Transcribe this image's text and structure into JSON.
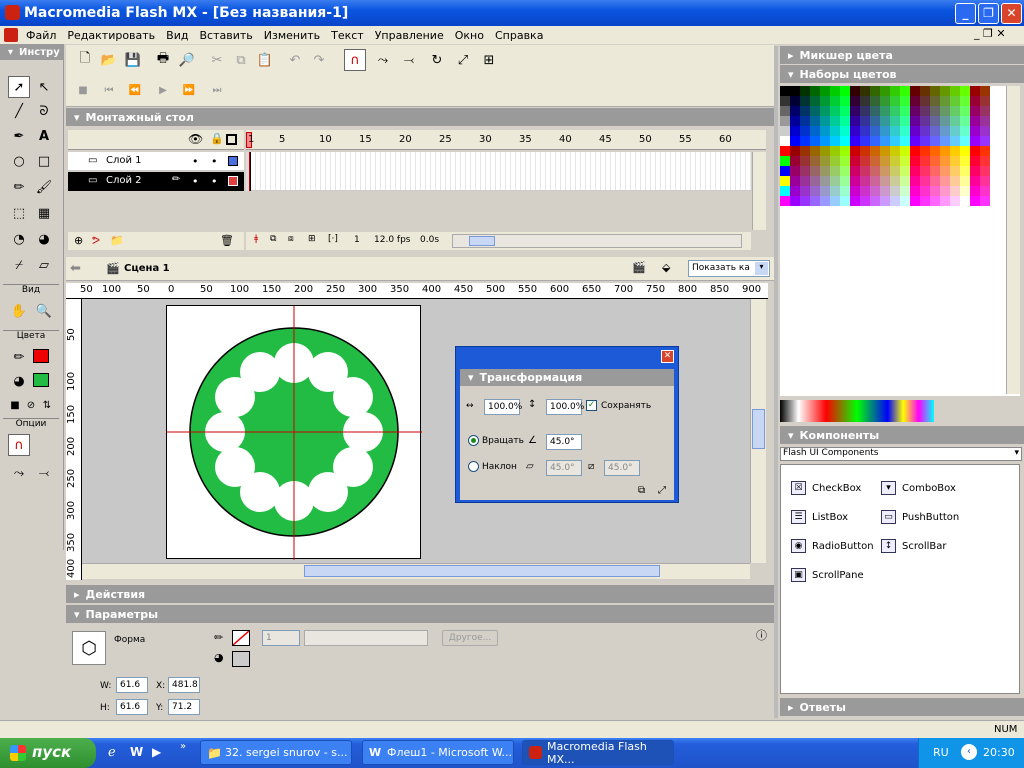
{
  "window": {
    "title": "Macromedia Flash MX - [Без названия-1]"
  },
  "menu": [
    "Файл",
    "Редактировать",
    "Вид",
    "Вставить",
    "Изменить",
    "Текст",
    "Управление",
    "Окно",
    "Справка"
  ],
  "tools": {
    "title": "Инстру",
    "view_label": "Вид",
    "colors_label": "Цвета",
    "options_label": "Опции"
  },
  "timeline": {
    "title": "Монтажный стол",
    "frame_numbers": [
      "1",
      "5",
      "10",
      "15",
      "20",
      "25",
      "30",
      "35",
      "40",
      "45",
      "50",
      "55",
      "60"
    ],
    "layers": [
      {
        "name": "Слой 1",
        "color": "#4a70e0"
      },
      {
        "name": "Слой 2",
        "color": "#e04040"
      }
    ],
    "current_frame": "1",
    "fps": "12.0 fps",
    "time": "0.0s"
  },
  "scene": {
    "name": "Сцена 1",
    "zoom_select": "Показать ка"
  },
  "ruler_h": [
    "50",
    "100",
    "50",
    "0",
    "50",
    "100",
    "150",
    "200",
    "250",
    "300",
    "350",
    "400",
    "450",
    "500",
    "550",
    "600",
    "650",
    "700",
    "750",
    "800",
    "850",
    "900"
  ],
  "ruler_v": [
    "50",
    "100",
    "150",
    "200",
    "250",
    "300",
    "350",
    "400"
  ],
  "transform": {
    "title": "Трансформация",
    "width_pct": "100.0%",
    "height_pct": "100.0%",
    "keep_label": "Сохранять",
    "rotate_label": "Вращать",
    "rotate_value": "45.0°",
    "skew_label": "Наклон",
    "skew_h": "45.0°",
    "skew_v": "45.0°"
  },
  "actions": {
    "title": "Действия"
  },
  "properties": {
    "title": "Параметры",
    "shape_label": "Форма",
    "stroke_size": "1",
    "other_btn": "Другое...",
    "w_label": "W:",
    "w": "61.6",
    "h_label": "H:",
    "h": "61.6",
    "x_label": "X:",
    "x": "481.8",
    "y_label": "Y:",
    "y": "71.2"
  },
  "right": {
    "mixer_title": "Микшер цвета",
    "swatches_title": "Наборы цветов",
    "components_title": "Компоненты",
    "components_select": "Flash UI Components",
    "components": [
      "CheckBox",
      "ComboBox",
      "ListBox",
      "PushButton",
      "RadioButton",
      "ScrollBar",
      "ScrollPane"
    ],
    "answers_title": "Ответы"
  },
  "status": {
    "num": "NUM"
  },
  "taskbar": {
    "start": "пуск",
    "tasks": [
      "32. sergei snurov - s...",
      "Флеш1 - Microsoft W...",
      "Macromedia Flash MX..."
    ],
    "lang": "RU",
    "clock": "20:30"
  },
  "colors": {
    "green": "#22bb44",
    "red": "#ee0000",
    "blue_accent": "#0a55e0"
  }
}
